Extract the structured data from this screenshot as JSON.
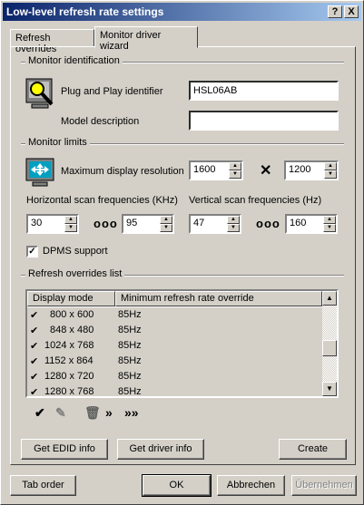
{
  "window": {
    "title": "Low-level refresh rate settings",
    "help_label": "?",
    "close_label": "X"
  },
  "tabs": [
    {
      "label": "Refresh overrides"
    },
    {
      "label": "Monitor driver wizard"
    }
  ],
  "identification": {
    "group_label": "Monitor identification",
    "pnp_label": "Plug and Play identifier",
    "pnp_value": "HSL06AB",
    "model_label": "Model description",
    "model_value": ""
  },
  "limits": {
    "group_label": "Monitor limits",
    "max_res_label": "Maximum display resolution",
    "max_width": "1600",
    "max_height": "1200",
    "hscan_label": "Horizontal scan frequencies (KHz)",
    "hscan_min": "30",
    "hscan_max": "95",
    "vscan_label": "Vertical scan frequencies (Hz)",
    "vscan_min": "47",
    "vscan_max": "160",
    "dpms_label": "DPMS support",
    "dpms_checked": true
  },
  "overrides": {
    "group_label": "Refresh overrides list",
    "col_mode": "Display mode",
    "col_rate": "Minimum refresh rate override",
    "rows": [
      {
        "mode": "800 x 600",
        "rate": "85Hz"
      },
      {
        "mode": "848 x 480",
        "rate": "85Hz"
      },
      {
        "mode": "1024 x 768",
        "rate": "85Hz"
      },
      {
        "mode": "1152 x 864",
        "rate": "85Hz"
      },
      {
        "mode": "1280 x 720",
        "rate": "85Hz"
      },
      {
        "mode": "1280 x 768",
        "rate": "85Hz"
      }
    ]
  },
  "buttons": {
    "get_edid": "Get EDID info",
    "get_driver": "Get driver info",
    "create": "Create",
    "tab_order": "Tab order",
    "ok": "OK",
    "cancel": "Abbrechen",
    "apply": "Übernehmen"
  }
}
